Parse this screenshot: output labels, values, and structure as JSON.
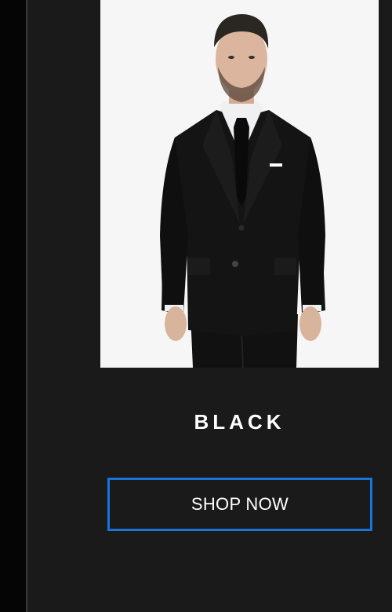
{
  "product": {
    "name": "BLACK",
    "image_subject": "model-in-black-suit"
  },
  "cta": {
    "label": "SHOP NOW"
  },
  "colors": {
    "background": "#1a1a1a",
    "left_strip": "#050505",
    "photo_bg": "#f6f6f6",
    "button_border": "#1a73d9",
    "text": "#ffffff"
  }
}
